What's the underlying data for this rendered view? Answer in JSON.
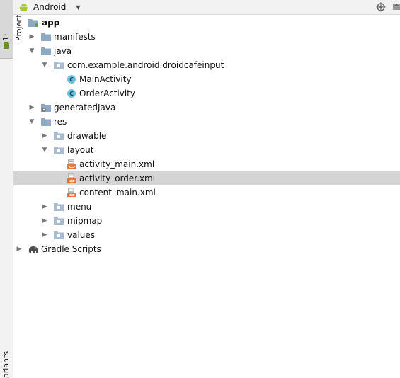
{
  "view_selector": {
    "label": "Android"
  },
  "sidebar": {
    "project_tab": "1: Project",
    "variants_tab": "ariants"
  },
  "tree": {
    "app": "app",
    "manifests": "manifests",
    "java": "java",
    "package": "com.example.android.droidcafeinput",
    "main_activity": "MainActivity",
    "order_activity": "OrderActivity",
    "generated_java": "generatedJava",
    "res": "res",
    "drawable": "drawable",
    "layout": "layout",
    "activity_main_xml": "activity_main.xml",
    "activity_order_xml": "activity_order.xml",
    "content_main_xml": "content_main.xml",
    "menu": "menu",
    "mipmap": "mipmap",
    "values": "values",
    "gradle_scripts": "Gradle Scripts"
  },
  "colors": {
    "folder": "#8fa9c3",
    "class_badge": "#6cc3e0",
    "android_green": "#a4c639",
    "xml_orange": "#e8743b",
    "selection": "#d4d4d4"
  }
}
